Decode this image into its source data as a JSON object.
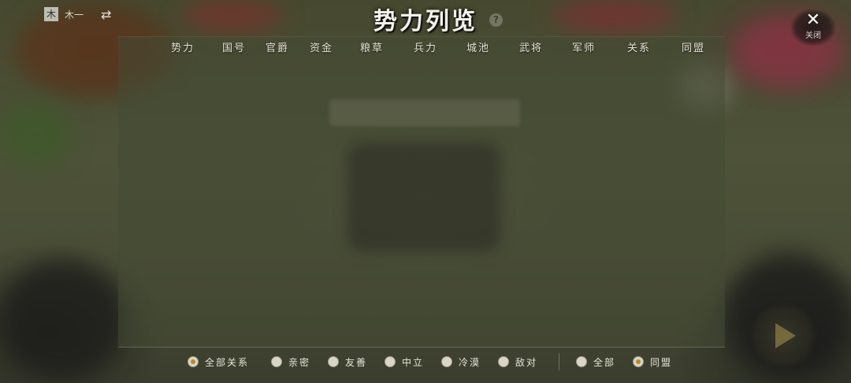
{
  "user": {
    "tag": "木",
    "name": "木一"
  },
  "title": "势力列览",
  "help_icon": "?",
  "close": {
    "icon": "✕",
    "label": "关闭"
  },
  "columns": [
    "势力",
    "国号",
    "官爵",
    "资金",
    "粮草",
    "兵力",
    "城池",
    "武将",
    "军师",
    "关系",
    "同盟"
  ],
  "relation_filters": [
    {
      "label": "全部关系",
      "selected": true
    },
    {
      "label": "亲密",
      "selected": false
    },
    {
      "label": "友善",
      "selected": false
    },
    {
      "label": "中立",
      "selected": false
    },
    {
      "label": "冷漠",
      "selected": false
    },
    {
      "label": "敌对",
      "selected": false
    }
  ],
  "alliance_filters": [
    {
      "label": "全部",
      "selected": false
    },
    {
      "label": "同盟",
      "selected": true
    }
  ],
  "colors": {
    "accent": "#b58a2a",
    "text": "#e6e3d7"
  }
}
